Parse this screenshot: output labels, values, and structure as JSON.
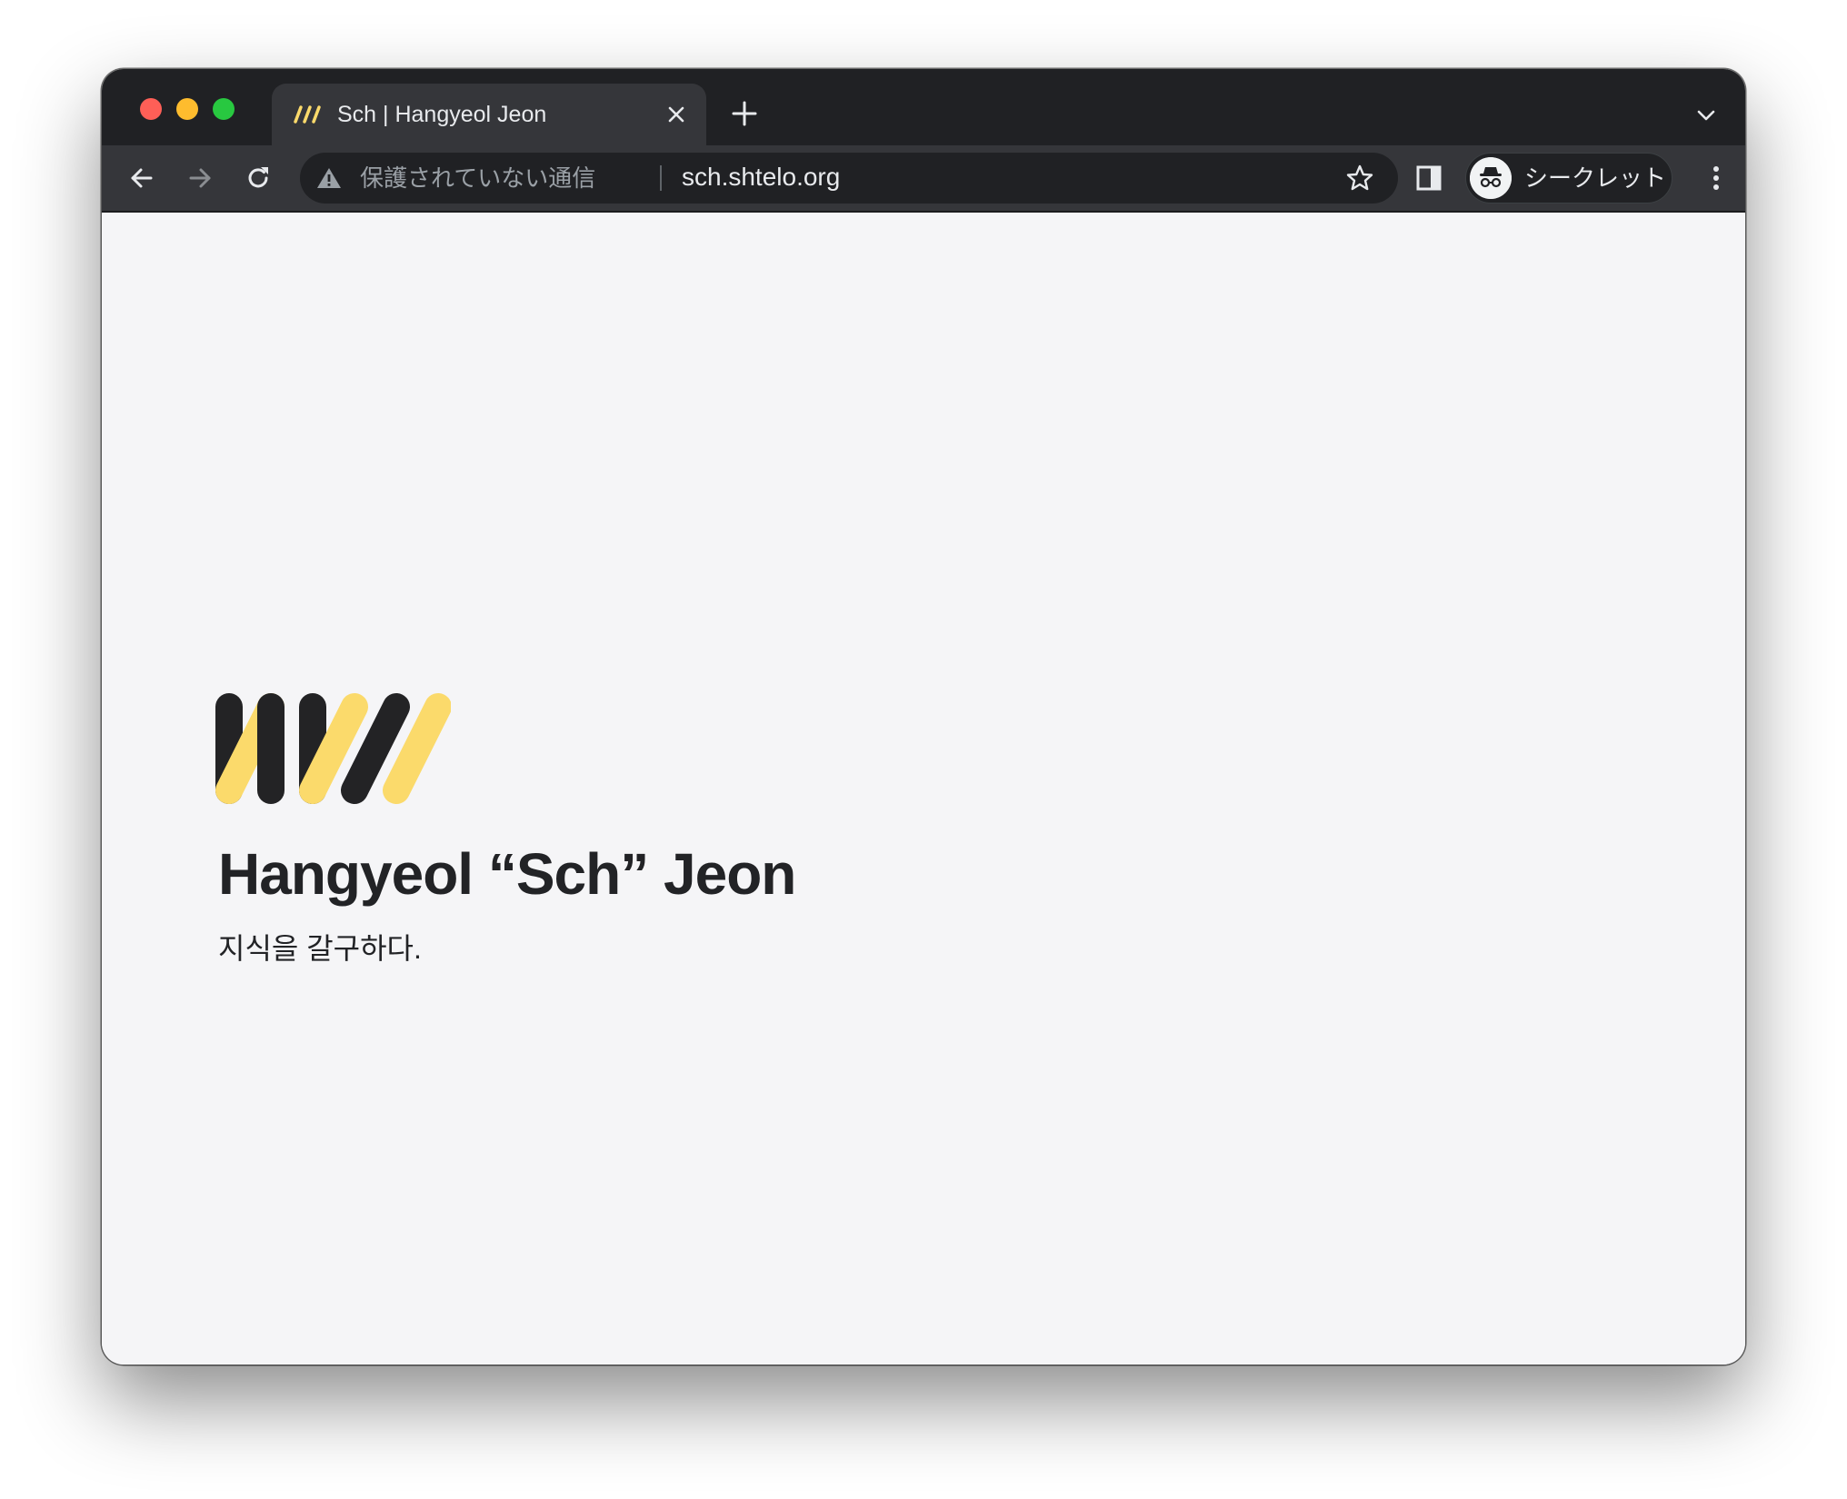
{
  "browser": {
    "tab": {
      "title": "Sch | Hangyeol Jeon"
    },
    "omnibox": {
      "security_status": "保護されていない通信",
      "url": "sch.shtelo.org"
    },
    "profile": {
      "label": "シークレット"
    }
  },
  "page": {
    "headline": "Hangyeol “Sch” Jeon",
    "tagline": "지식을 갈구하다."
  },
  "colors": {
    "brand_yellow": "#fbda6b",
    "brand_dark": "#232325",
    "page_background": "#f5f5f7",
    "chrome_dark": "#202124",
    "toolbar": "#35363a"
  }
}
